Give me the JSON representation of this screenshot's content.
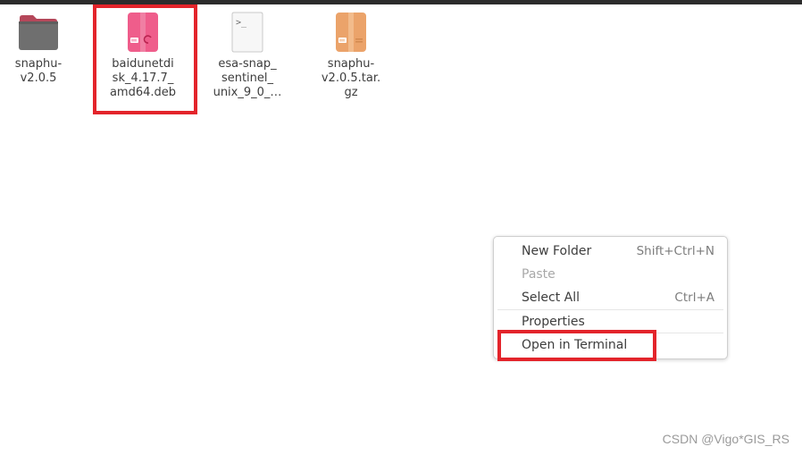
{
  "files": [
    {
      "name": "snaphu-\nv2.0.5",
      "icon": "folder-icon"
    },
    {
      "name": "baidunetdi\nsk_4.17.7_\namd64.deb",
      "icon": "deb-package-icon"
    },
    {
      "name": "esa-snap_\nsentinel_\nunix_9_0_…",
      "icon": "executable-script-icon",
      "icon_text": ">_"
    },
    {
      "name": "snaphu-\nv2.0.5.tar.\ngz",
      "icon": "archive-icon"
    }
  ],
  "context_menu": {
    "items": [
      {
        "label": "New Folder",
        "shortcut": "Shift+Ctrl+N",
        "enabled": true
      },
      {
        "label": "Paste",
        "shortcut": "",
        "enabled": false
      },
      {
        "label": "Select All",
        "shortcut": "Ctrl+A",
        "enabled": true
      },
      {
        "label": "Properties",
        "shortcut": "",
        "enabled": true
      },
      {
        "label": "Open in Terminal",
        "shortcut": "",
        "enabled": true
      }
    ]
  },
  "watermark": "CSDN @Vigo*GIS_RS",
  "colors": {
    "highlight": "#e3242b",
    "folder": "#6f6f6f",
    "folder_tab": "#b5475a",
    "deb": "#ef5d8b",
    "archive": "#eba36a"
  }
}
